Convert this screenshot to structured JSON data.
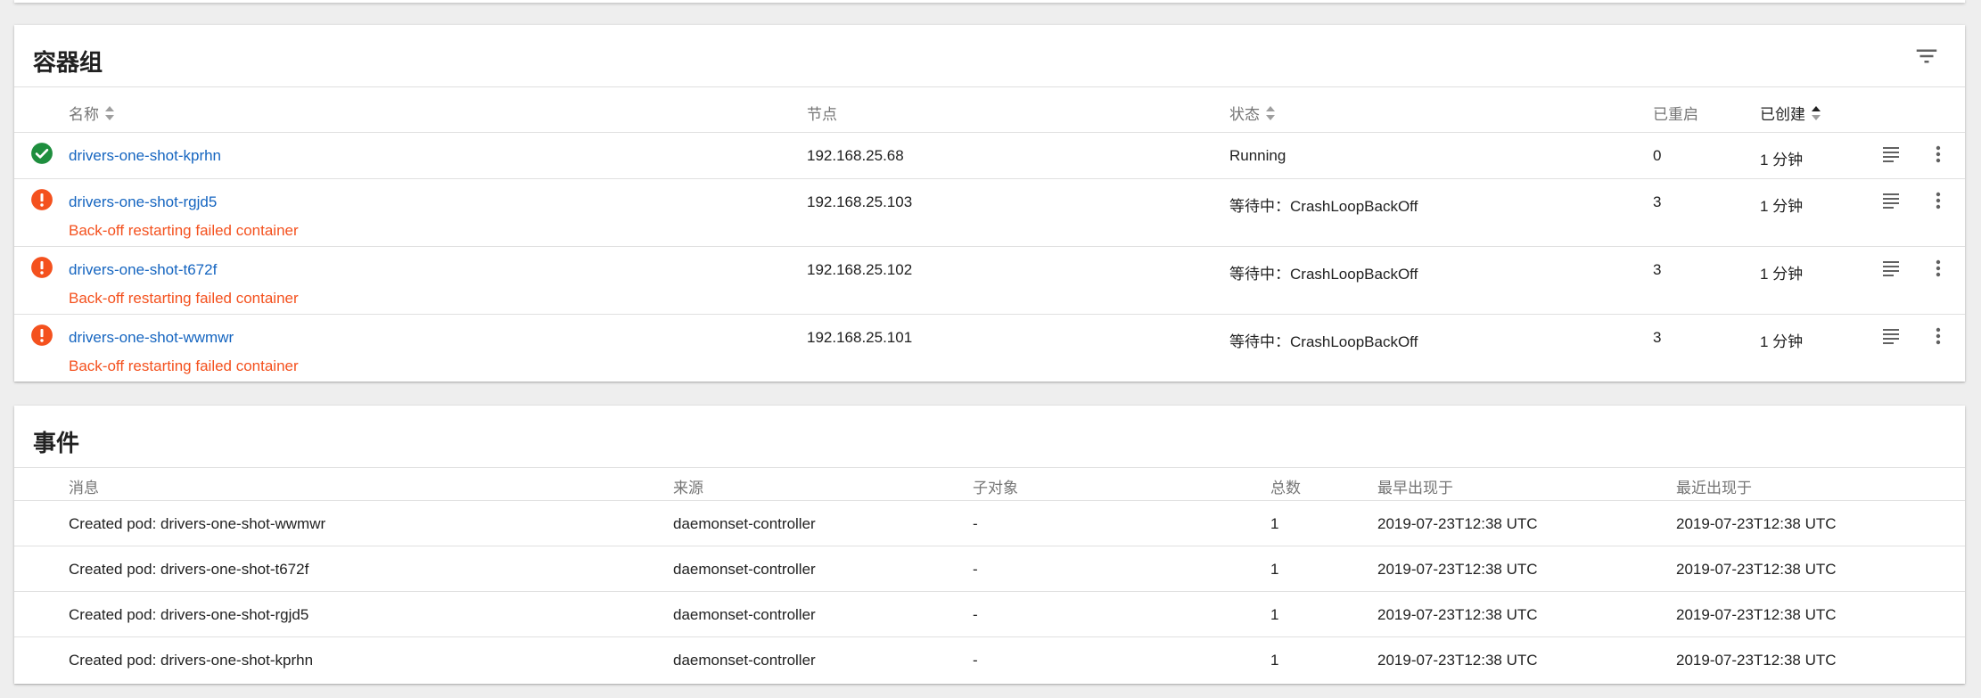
{
  "pods": {
    "title": "容器组",
    "columns": {
      "name": "名称",
      "node": "节点",
      "status": "状态",
      "restarts": "已重启",
      "created": "已创建"
    },
    "rows": [
      {
        "name": "drivers-one-shot-kprhn",
        "node": "192.168.25.68",
        "status": "Running",
        "restarts": "0",
        "created": "1 分钟",
        "state": "ok",
        "message": ""
      },
      {
        "name": "drivers-one-shot-rgjd5",
        "node": "192.168.25.103",
        "status": "等待中：CrashLoopBackOff",
        "restarts": "3",
        "created": "1 分钟",
        "state": "error",
        "message": "Back-off restarting failed container"
      },
      {
        "name": "drivers-one-shot-t672f",
        "node": "192.168.25.102",
        "status": "等待中：CrashLoopBackOff",
        "restarts": "3",
        "created": "1 分钟",
        "state": "error",
        "message": "Back-off restarting failed container"
      },
      {
        "name": "drivers-one-shot-wwmwr",
        "node": "192.168.25.101",
        "status": "等待中：CrashLoopBackOff",
        "restarts": "3",
        "created": "1 分钟",
        "state": "error",
        "message": "Back-off restarting failed container"
      }
    ]
  },
  "events": {
    "title": "事件",
    "columns": {
      "message": "消息",
      "source": "来源",
      "subobject": "子对象",
      "count": "总数",
      "first_seen": "最早出现于",
      "last_seen": "最近出现于"
    },
    "rows": [
      {
        "message": "Created pod: drivers-one-shot-wwmwr",
        "source": "daemonset-controller",
        "subobject": "-",
        "count": "1",
        "first_seen": "2019-07-23T12:38 UTC",
        "last_seen": "2019-07-23T12:38 UTC"
      },
      {
        "message": "Created pod: drivers-one-shot-t672f",
        "source": "daemonset-controller",
        "subobject": "-",
        "count": "1",
        "first_seen": "2019-07-23T12:38 UTC",
        "last_seen": "2019-07-23T12:38 UTC"
      },
      {
        "message": "Created pod: drivers-one-shot-rgjd5",
        "source": "daemonset-controller",
        "subobject": "-",
        "count": "1",
        "first_seen": "2019-07-23T12:38 UTC",
        "last_seen": "2019-07-23T12:38 UTC"
      },
      {
        "message": "Created pod: drivers-one-shot-kprhn",
        "source": "daemonset-controller",
        "subobject": "-",
        "count": "1",
        "first_seen": "2019-07-23T12:38 UTC",
        "last_seen": "2019-07-23T12:38 UTC"
      }
    ]
  },
  "icons": {
    "ok": "check-circle-icon",
    "error": "error-circle-icon",
    "logs": "logs-icon",
    "more": "more-vert-icon",
    "filter": "filter-list-icon",
    "sort": "sort-icon"
  },
  "colors": {
    "link": "#1565c0",
    "ok": "#1e8e3e",
    "error": "#f4511e",
    "background": "#eeeeee"
  }
}
